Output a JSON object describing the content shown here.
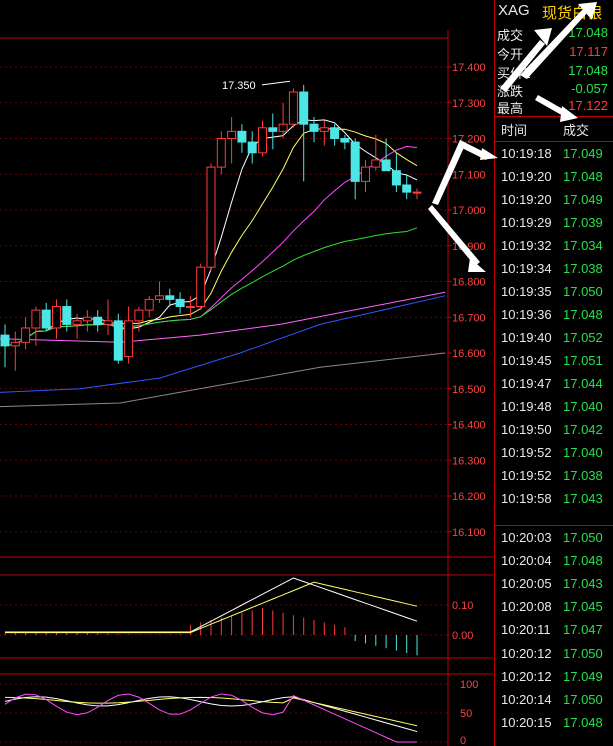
{
  "symbol": {
    "code": "XAG",
    "name": "现货白银"
  },
  "quote": [
    {
      "label": "成交",
      "value": "17.048",
      "color": "#26e04a"
    },
    {
      "label": "今开",
      "value": "17.117",
      "color": "#ff3b3b"
    },
    {
      "label": "买价1",
      "value": "17.048",
      "color": "#26e04a"
    },
    {
      "label": "涨跌",
      "value": "-0.057",
      "color": "#26e04a"
    },
    {
      "label": "最高",
      "value": "17.122",
      "color": "#ff3b3b"
    }
  ],
  "ticks_header": {
    "time": "时间",
    "price": "成交"
  },
  "ticks": [
    {
      "time": "10:19:18",
      "price": "17.049"
    },
    {
      "time": "10:19:20",
      "price": "17.048"
    },
    {
      "time": "10:19:20",
      "price": "17.049"
    },
    {
      "time": "10:19:29",
      "price": "17.039"
    },
    {
      "time": "10:19:32",
      "price": "17.034"
    },
    {
      "time": "10:19:34",
      "price": "17.038"
    },
    {
      "time": "10:19:35",
      "price": "17.050"
    },
    {
      "time": "10:19:36",
      "price": "17.048"
    },
    {
      "time": "10:19:40",
      "price": "17.052"
    },
    {
      "time": "10:19:45",
      "price": "17.051"
    },
    {
      "time": "10:19:47",
      "price": "17.044"
    },
    {
      "time": "10:19:48",
      "price": "17.040"
    },
    {
      "time": "10:19:50",
      "price": "17.042"
    },
    {
      "time": "10:19:52",
      "price": "17.040"
    },
    {
      "time": "10:19:52",
      "price": "17.038"
    },
    {
      "time": "10:19:58",
      "price": "17.043"
    },
    {
      "time": "10:20:03",
      "price": "17.050"
    },
    {
      "time": "10:20:04",
      "price": "17.048"
    },
    {
      "time": "10:20:05",
      "price": "17.043"
    },
    {
      "time": "10:20:08",
      "price": "17.045"
    },
    {
      "time": "10:20:11",
      "price": "17.047"
    },
    {
      "time": "10:20:12",
      "price": "17.050"
    },
    {
      "time": "10:20:12",
      "price": "17.049"
    },
    {
      "time": "10:20:14",
      "price": "17.050"
    },
    {
      "time": "10:20:15",
      "price": "17.048"
    }
  ],
  "chart_data": {
    "type": "candlestick",
    "price_axis": {
      "ticks": [
        "17.400",
        "17.300",
        "17.200",
        "17.100",
        "17.000",
        "16.900",
        "16.800",
        "16.700",
        "16.600",
        "16.500",
        "16.400",
        "16.300",
        "16.200",
        "16.100"
      ],
      "range": [
        16.08,
        17.46
      ]
    },
    "annotation": "17.350",
    "candles": [
      {
        "o": 16.65,
        "h": 16.68,
        "l": 16.56,
        "c": 16.62
      },
      {
        "o": 16.62,
        "h": 16.66,
        "l": 16.55,
        "c": 16.63
      },
      {
        "o": 16.63,
        "h": 16.7,
        "l": 16.61,
        "c": 16.67
      },
      {
        "o": 16.67,
        "h": 16.73,
        "l": 16.62,
        "c": 16.72
      },
      {
        "o": 16.72,
        "h": 16.74,
        "l": 16.66,
        "c": 16.67
      },
      {
        "o": 16.67,
        "h": 16.75,
        "l": 16.64,
        "c": 16.73
      },
      {
        "o": 16.73,
        "h": 16.75,
        "l": 16.66,
        "c": 16.68
      },
      {
        "o": 16.68,
        "h": 16.71,
        "l": 16.64,
        "c": 16.69
      },
      {
        "o": 16.69,
        "h": 16.72,
        "l": 16.66,
        "c": 16.7
      },
      {
        "o": 16.7,
        "h": 16.72,
        "l": 16.66,
        "c": 16.68
      },
      {
        "o": 16.68,
        "h": 16.75,
        "l": 16.65,
        "c": 16.69
      },
      {
        "o": 16.69,
        "h": 16.71,
        "l": 16.57,
        "c": 16.58
      },
      {
        "o": 16.59,
        "h": 16.73,
        "l": 16.57,
        "c": 16.69
      },
      {
        "o": 16.69,
        "h": 16.73,
        "l": 16.66,
        "c": 16.72
      },
      {
        "o": 16.72,
        "h": 16.76,
        "l": 16.7,
        "c": 16.75
      },
      {
        "o": 16.75,
        "h": 16.8,
        "l": 16.74,
        "c": 16.76
      },
      {
        "o": 16.76,
        "h": 16.78,
        "l": 16.73,
        "c": 16.75
      },
      {
        "o": 16.75,
        "h": 16.77,
        "l": 16.71,
        "c": 16.73
      },
      {
        "o": 16.73,
        "h": 16.76,
        "l": 16.7,
        "c": 16.73
      },
      {
        "o": 16.73,
        "h": 16.85,
        "l": 16.72,
        "c": 16.84
      },
      {
        "o": 16.84,
        "h": 17.13,
        "l": 16.83,
        "c": 17.12
      },
      {
        "o": 17.12,
        "h": 17.22,
        "l": 17.1,
        "c": 17.2
      },
      {
        "o": 17.2,
        "h": 17.26,
        "l": 17.13,
        "c": 17.22
      },
      {
        "o": 17.22,
        "h": 17.24,
        "l": 17.16,
        "c": 17.19
      },
      {
        "o": 17.19,
        "h": 17.22,
        "l": 17.13,
        "c": 17.16
      },
      {
        "o": 17.16,
        "h": 17.25,
        "l": 17.15,
        "c": 17.23
      },
      {
        "o": 17.23,
        "h": 17.27,
        "l": 17.17,
        "c": 17.22
      },
      {
        "o": 17.22,
        "h": 17.3,
        "l": 17.2,
        "c": 17.24
      },
      {
        "o": 17.24,
        "h": 17.34,
        "l": 17.23,
        "c": 17.33
      },
      {
        "o": 17.33,
        "h": 17.35,
        "l": 17.08,
        "c": 17.24
      },
      {
        "o": 17.24,
        "h": 17.26,
        "l": 17.19,
        "c": 17.22
      },
      {
        "o": 17.22,
        "h": 17.25,
        "l": 17.18,
        "c": 17.23
      },
      {
        "o": 17.23,
        "h": 17.24,
        "l": 17.18,
        "c": 17.2
      },
      {
        "o": 17.2,
        "h": 17.21,
        "l": 17.17,
        "c": 17.19
      },
      {
        "o": 17.19,
        "h": 17.2,
        "l": 17.03,
        "c": 17.08
      },
      {
        "o": 17.08,
        "h": 17.14,
        "l": 17.05,
        "c": 17.12
      },
      {
        "o": 17.12,
        "h": 17.21,
        "l": 17.11,
        "c": 17.14
      },
      {
        "o": 17.14,
        "h": 17.2,
        "l": 17.11,
        "c": 17.11
      },
      {
        "o": 17.11,
        "h": 17.16,
        "l": 17.05,
        "c": 17.07
      },
      {
        "o": 17.07,
        "h": 17.1,
        "l": 17.03,
        "c": 17.05
      },
      {
        "o": 17.05,
        "h": 17.06,
        "l": 17.03,
        "c": 17.05
      }
    ],
    "macd": {
      "ticks": [
        "0.10",
        "0.00"
      ]
    },
    "kdj": {
      "ticks": [
        "100",
        "50",
        "0"
      ]
    }
  },
  "colors": {
    "up": "#ff3b3b",
    "down": "#4de6e6",
    "grid": "#8b0000",
    "ma5": "#ffffff",
    "ma10": "#ffff66",
    "ma20": "#ff4dff",
    "ma40": "#33dd33",
    "ma60": "#3355ff",
    "ma120": "#ff66ff",
    "ma250": "#888888"
  }
}
